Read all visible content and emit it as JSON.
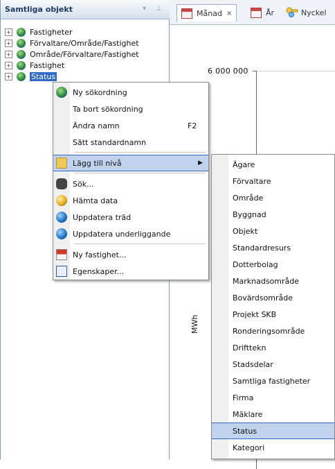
{
  "left_panel": {
    "title": "Samtliga objekt",
    "pin_icon": "pin-icon",
    "dropdown_icon": "dropdown-arrow-icon",
    "tree": [
      {
        "label": "Fastigheter",
        "expander": "+",
        "icon": "globe-icon"
      },
      {
        "label": "Förvaltare/Område/Fastighet",
        "expander": "+",
        "icon": "globe-icon"
      },
      {
        "label": "Område/Förvaltare/Fastighet",
        "expander": "+",
        "icon": "globe-icon"
      },
      {
        "label": "Fastighet",
        "expander": "+",
        "icon": "globe-icon"
      },
      {
        "label": "Status",
        "expander": "+",
        "icon": "globe-icon",
        "selected": true
      }
    ]
  },
  "tabs": [
    {
      "label": "Månad",
      "close": "×",
      "icon": "calendar-icon",
      "active": true
    },
    {
      "label": "År",
      "icon": "calendar-icon"
    },
    {
      "label": "Nyckel",
      "icon": "key-icon"
    }
  ],
  "chart": {
    "y_tick_label": "6 000 000",
    "y_axis_label": "MWh"
  },
  "context_menu": {
    "items": [
      {
        "label": "Ny sökordning",
        "icon": "globe-icon"
      },
      {
        "label": "Ta bort sökordning",
        "icon": ""
      },
      {
        "label": "Ändra namn",
        "shortcut": "F2",
        "icon": ""
      },
      {
        "label": "Sätt standardnamn",
        "icon": ""
      },
      {
        "label": "Lägg till nivå",
        "icon": "folder-add-icon",
        "submenu": true,
        "highlighted": true
      },
      {
        "label": "Sök...",
        "icon": "binoculars-icon"
      },
      {
        "label": "Hämta data",
        "icon": "fetch-data-icon"
      },
      {
        "label": "Uppdatera träd",
        "icon": "refresh-icon"
      },
      {
        "label": "Uppdatera underliggande",
        "icon": "refresh-icon"
      },
      {
        "label": "Ny fastighet...",
        "icon": "new-property-icon"
      },
      {
        "label": "Egenskaper...",
        "icon": "properties-icon"
      }
    ],
    "submenu_arrow": "▶"
  },
  "submenu": {
    "items": [
      "Ägare",
      "Förvaltare",
      "Område",
      "Byggnad",
      "Objekt",
      "Standardresurs",
      "Dotterbolag",
      "Marknadsområde",
      "Bovärdsområde",
      "Projekt SKB",
      "Ronderingsområde",
      "Drifttekn",
      "Stadsdelar",
      "Samtliga fastigheter",
      "Firma",
      "Mäklare",
      "Status",
      "Kategori"
    ],
    "highlighted": "Status"
  },
  "colors": {
    "selection": "#316ac5",
    "menu_highlight": "#c1d2ee",
    "header_text": "#1f3a63"
  }
}
